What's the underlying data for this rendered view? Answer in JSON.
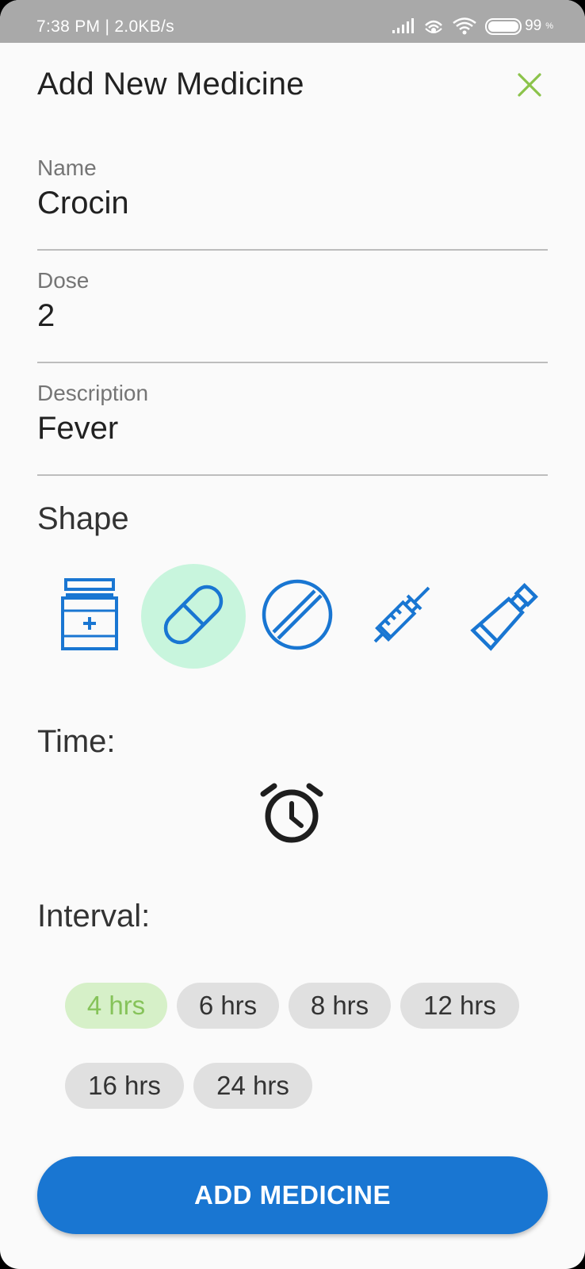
{
  "status_bar": {
    "time": "7:38 PM | 2.0KB/s",
    "battery_percent": "99",
    "battery_unit": "%",
    "icons": [
      "signal-icon",
      "hotspot-icon",
      "wifi-icon",
      "battery-icon"
    ]
  },
  "dialog": {
    "title": "Add New Medicine",
    "close_icon": "close-icon",
    "accent_color": "#8bc34a"
  },
  "fields": {
    "name": {
      "label": "Name",
      "value": "Crocin"
    },
    "dose": {
      "label": "Dose",
      "value": "2"
    },
    "description": {
      "label": "Description",
      "value": "Fever"
    }
  },
  "shape": {
    "label": "Shape",
    "options": [
      "bottle-icon",
      "capsule-icon",
      "tablet-icon",
      "syringe-icon",
      "tube-icon"
    ],
    "selected": "capsule-icon",
    "icon_color": "#1976d2",
    "selected_bg": "#c8f5dd"
  },
  "time": {
    "label": "Time:",
    "icon": "alarm-clock-icon"
  },
  "interval": {
    "label": "Interval:",
    "options": [
      "4 hrs",
      "6 hrs",
      "8 hrs",
      "12 hrs",
      "16 hrs",
      "24 hrs"
    ],
    "selected": "4 hrs"
  },
  "submit_button": {
    "label": "ADD MEDICINE",
    "color": "#1976d2"
  }
}
